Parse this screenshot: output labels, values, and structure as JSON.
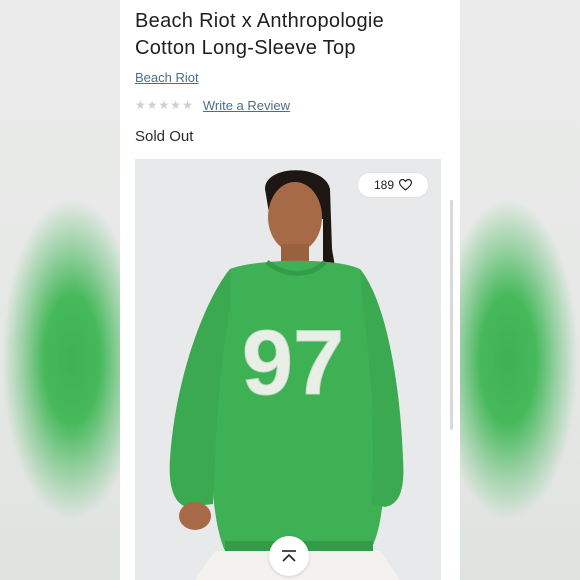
{
  "product": {
    "title": "Beach Riot x Anthropologie Cotton Long-Sleeve Top",
    "brand": "Beach Riot",
    "rating_stars": 0,
    "review_link": "Write a Review",
    "stock_status": "Sold Out"
  },
  "image": {
    "likes": "189",
    "graphic_text": "97",
    "sweatshirt_color": "#3fb155"
  },
  "icons": {
    "like": "heart-outline-icon",
    "scroll_top": "chevron-up-icon"
  }
}
